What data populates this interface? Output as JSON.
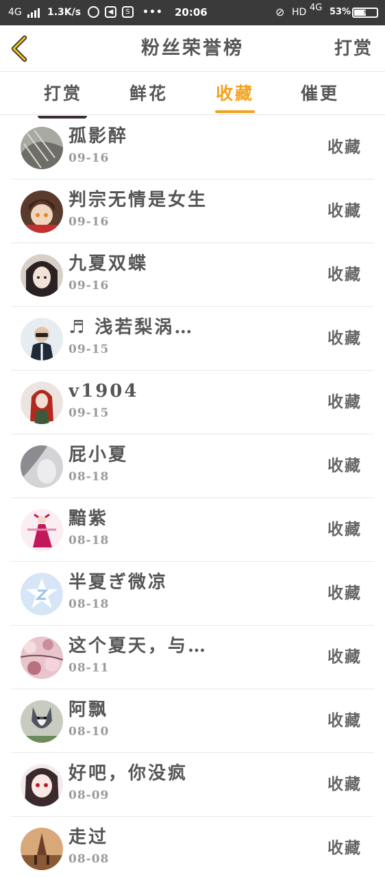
{
  "status_bar": {
    "network": "4G",
    "speed": "1.3K/s",
    "dots": "•••",
    "time": "20:06",
    "hd": "HD",
    "net_type": "4G",
    "battery": "53%",
    "battery_level": 0.53
  },
  "header": {
    "title": "粉丝荣誉榜",
    "action_label": "打赏"
  },
  "tabs": [
    {
      "label": "打赏",
      "active": false
    },
    {
      "label": "鲜花",
      "active": false
    },
    {
      "label": "收藏",
      "active": true
    },
    {
      "label": "催更",
      "active": false
    }
  ],
  "accent_color": "#f5a21b",
  "fans": [
    {
      "name": "孤影醉",
      "date": "09-16",
      "action": "收藏"
    },
    {
      "name": "判宗无情是女生",
      "date": "09-16",
      "action": "收藏"
    },
    {
      "name": "九夏双蝶",
      "date": "09-16",
      "action": "收藏"
    },
    {
      "name": "♬ 浅若梨涡…",
      "date": "09-15",
      "action": "收藏"
    },
    {
      "name": "v1904",
      "date": "09-15",
      "action": "收藏"
    },
    {
      "name": "屁小夏",
      "date": "08-18",
      "action": "收藏"
    },
    {
      "name": "黯紫",
      "date": "08-18",
      "action": "收藏"
    },
    {
      "name": "半夏ぎ微凉",
      "date": "08-18",
      "action": "收藏"
    },
    {
      "name": "这个夏天，与…",
      "date": "08-11",
      "action": "收藏"
    },
    {
      "name": "阿飘",
      "date": "08-10",
      "action": "收藏"
    },
    {
      "name": "好吧，你没疯",
      "date": "08-09",
      "action": "收藏"
    },
    {
      "name": "走过",
      "date": "08-08",
      "action": "收藏"
    }
  ]
}
